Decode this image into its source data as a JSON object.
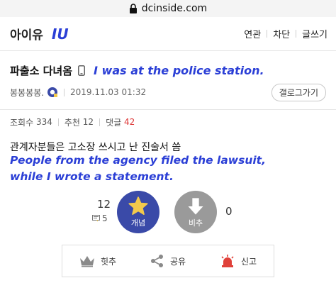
{
  "urlbar": {
    "domain": "dcinside.com"
  },
  "header": {
    "gallery_name": "아이유",
    "overlay_text": "IU",
    "menu": [
      "연관",
      "차단",
      "글쓰기"
    ]
  },
  "post": {
    "title": "파출소 다녀옴",
    "overlay_title": "I was at the police station.",
    "author": "봉봉봉봉.",
    "date": "2019.11.03 01:32",
    "back_button": "갤로그가기",
    "stats": {
      "views_label": "조회수",
      "views": "334",
      "recommend_label": "추천",
      "recommend": "12",
      "comments_label": "댓글",
      "comments": "42"
    },
    "body": "관계자분들은 고소장 쓰시고 난 진술서 씀",
    "overlay_body_line1": "People from the agency filed the lawsuit,",
    "overlay_body_line2": "while I wrote a statement."
  },
  "votes": {
    "up_count": "12",
    "reply_count": "5",
    "up_label": "개념",
    "down_label": "비추",
    "down_count": "0"
  },
  "actions": {
    "hit_label": "힛추",
    "share_label": "공유",
    "report_label": "신고"
  },
  "colors": {
    "accent": "#3a4aa8",
    "overlay": "#2b3fd6",
    "star": "#f2c94c",
    "report": "#e0413a"
  }
}
